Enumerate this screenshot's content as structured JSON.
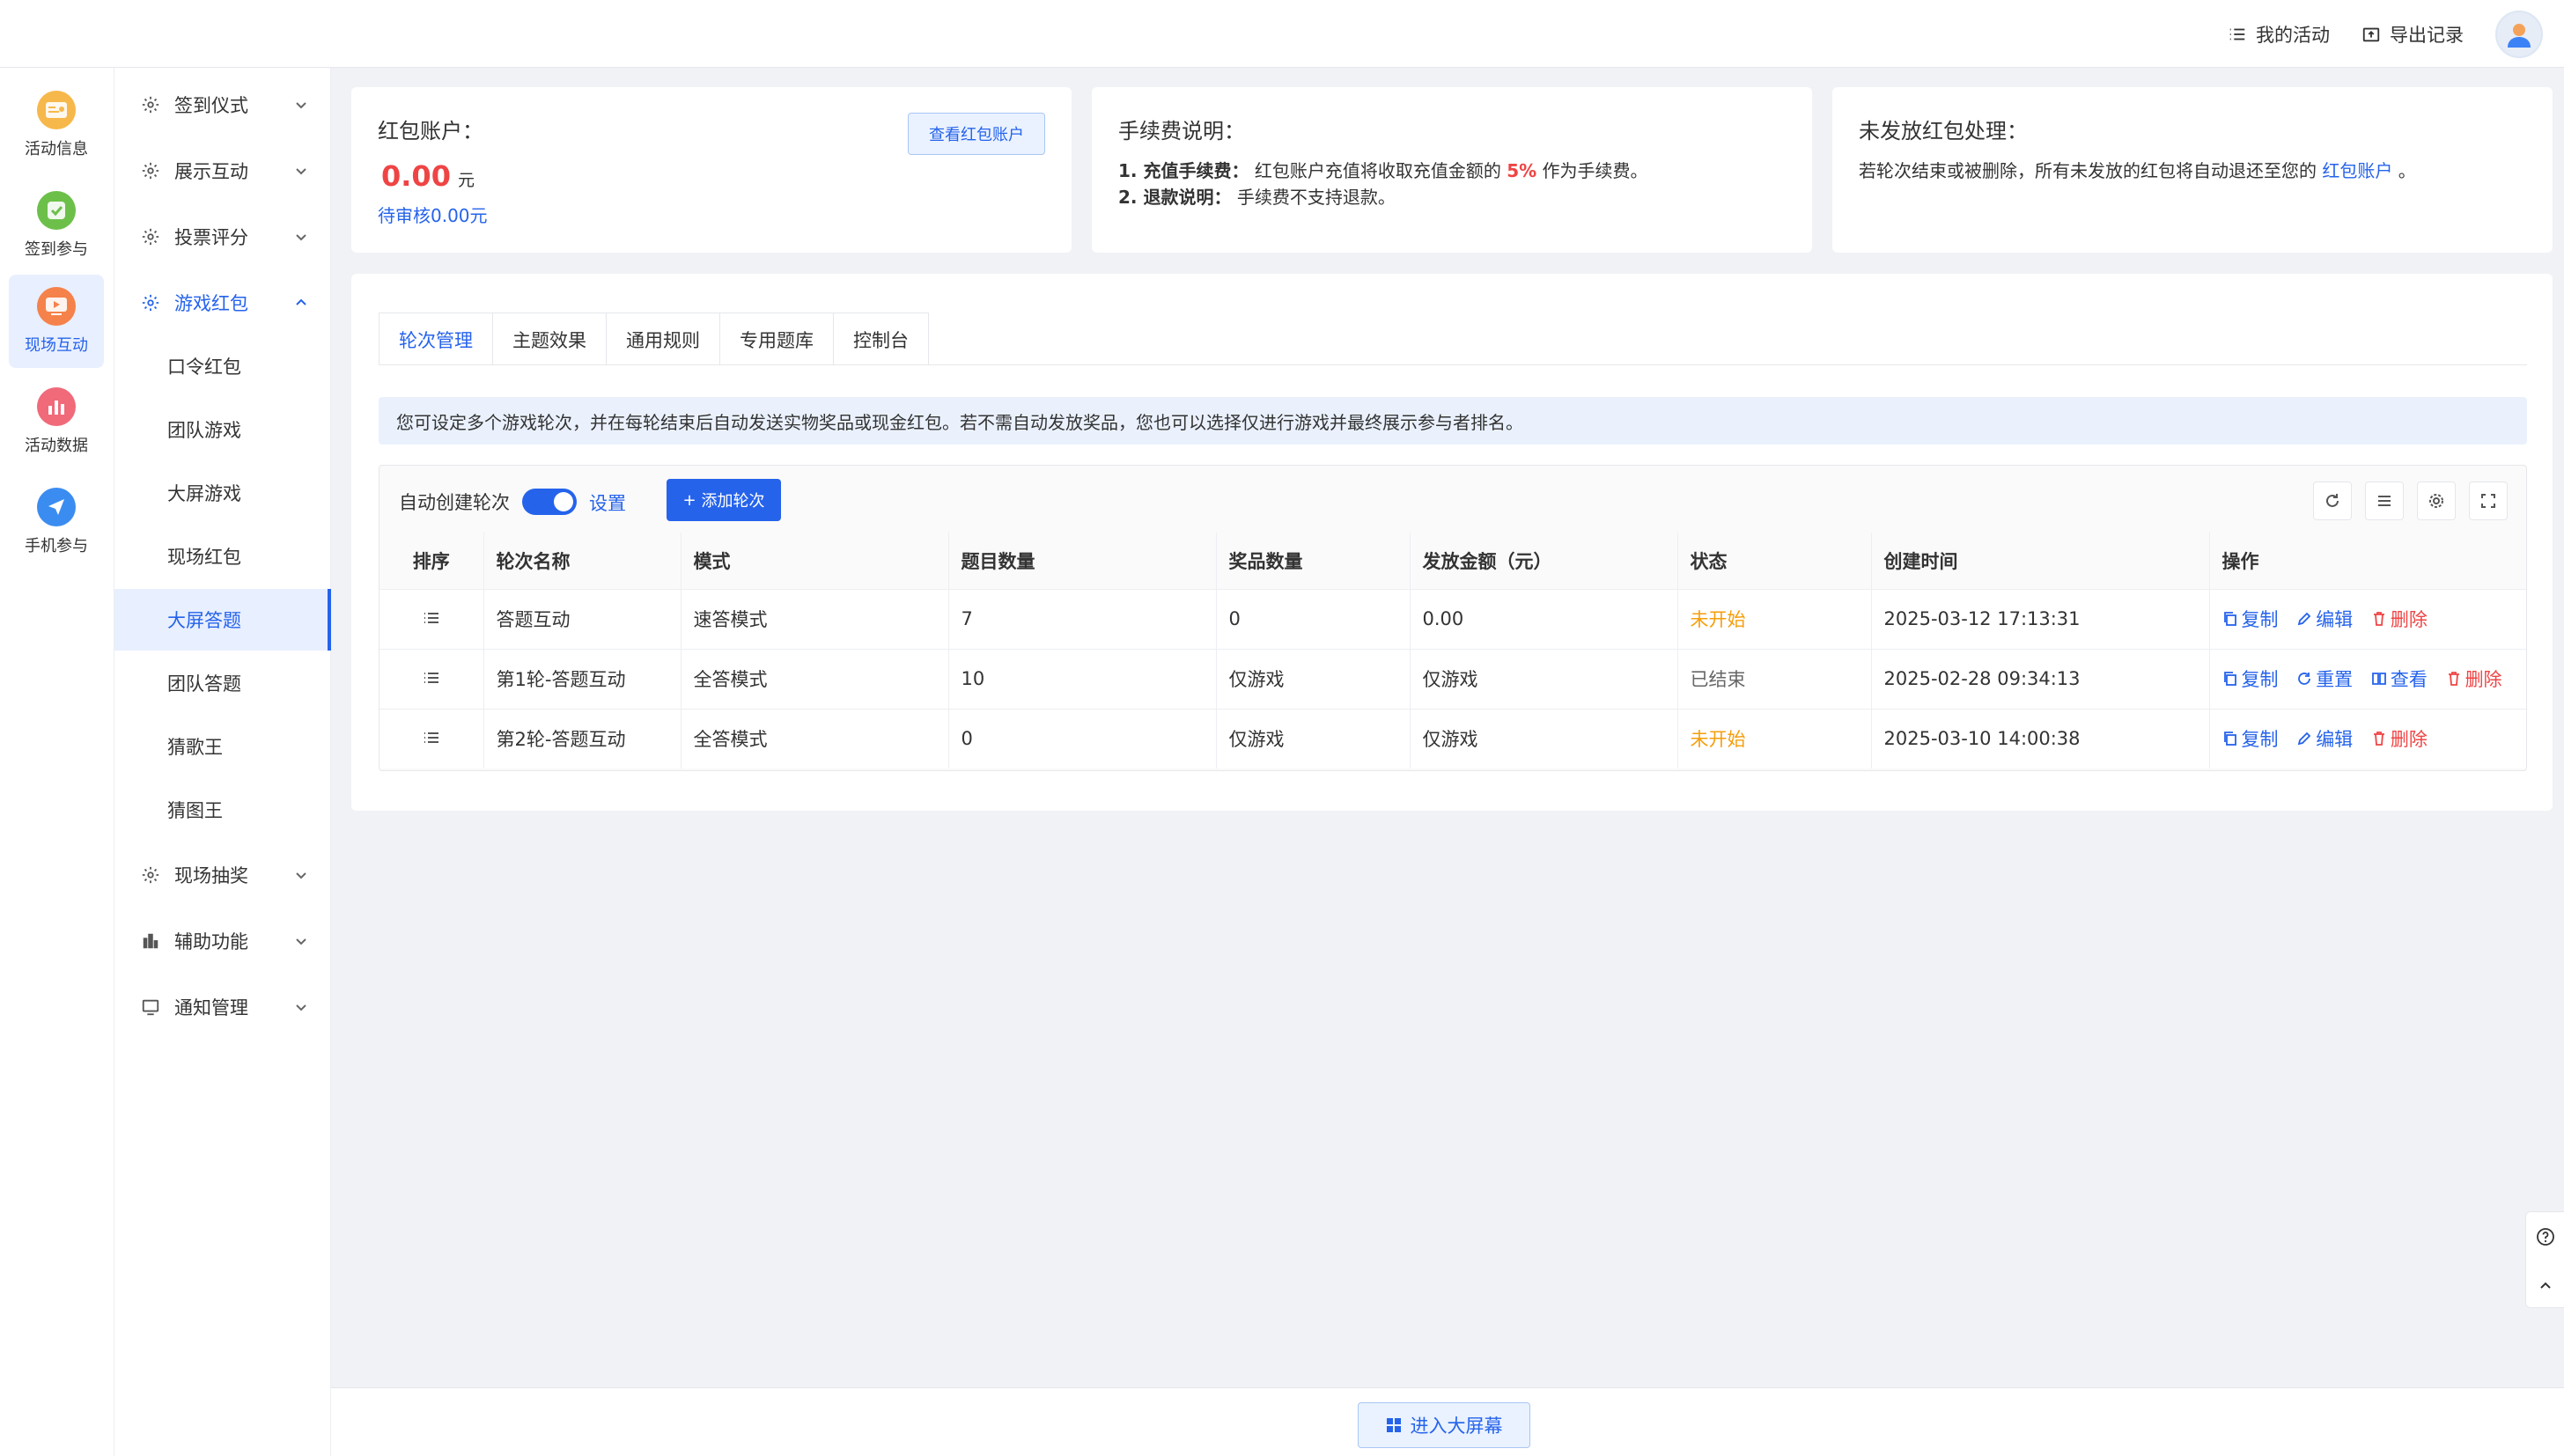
{
  "header": {
    "my_activity": "我的活动",
    "export_records": "导出记录"
  },
  "left_nav": [
    {
      "label": "活动信息",
      "icon": "activity-info-icon"
    },
    {
      "label": "签到参与",
      "icon": "checkin-icon"
    },
    {
      "label": "现场互动",
      "icon": "live-interaction-icon"
    },
    {
      "label": "活动数据",
      "icon": "activity-data-icon"
    },
    {
      "label": "手机参与",
      "icon": "mobile-icon"
    }
  ],
  "sub_nav": {
    "groups": {
      "g0": "签到仪式",
      "g1": "展示互动",
      "g2": "投票评分",
      "g3": "游戏红包",
      "g4": "现场抽奖",
      "g5": "辅助功能",
      "g6": "通知管理"
    },
    "items": [
      "口令红包",
      "团队游戏",
      "大屏游戏",
      "现场红包",
      "大屏答题",
      "团队答题",
      "猜歌王",
      "猜图王"
    ]
  },
  "cards": {
    "wallet": {
      "title": "红包账户：",
      "amount": "0.00",
      "unit": "元",
      "pending": "待审核0.00元",
      "button": "查看红包账户"
    },
    "fee": {
      "title": "手续费说明：",
      "l1_label": "1. 充值手续费：",
      "l1_text_a": "红包账户充值将收取充值金额的",
      "l1_rate": "5%",
      "l1_text_b": "作为手续费。",
      "l2_label": "2. 退款说明：",
      "l2_text": "手续费不支持退款。"
    },
    "unissued": {
      "title": "未发放红包处理：",
      "text_a": "若轮次结束或被删除，所有未发放的红包将自动退还至您的",
      "link": "红包账户",
      "text_b": "。"
    }
  },
  "tabs": [
    "轮次管理",
    "主题效果",
    "通用规则",
    "专用题库",
    "控制台"
  ],
  "notice": "您可设定多个游戏轮次，并在每轮结束后自动发送实物奖品或现金红包。若不需自动发放奖品，您也可以选择仅进行游戏并最终展示参与者排名。",
  "toolbar": {
    "auto_create": "自动创建轮次",
    "auto_create_on": true,
    "settings": "设置",
    "add_round": "添加轮次"
  },
  "table": {
    "headers": [
      "排序",
      "轮次名称",
      "模式",
      "题目数量",
      "奖品数量",
      "发放金额（元）",
      "状态",
      "创建时间",
      "操作"
    ],
    "rows": [
      {
        "name": "答题互动",
        "mode": "速答模式",
        "questions": "7",
        "prizes": "0",
        "amount": "0.00",
        "status": "未开始",
        "status_color": "#f59e0b",
        "created": "2025-03-12 17:13:31",
        "ops": [
          "复制",
          "编辑",
          "删除"
        ]
      },
      {
        "name": "第1轮-答题互动",
        "mode": "全答模式",
        "questions": "10",
        "prizes": "仅游戏",
        "amount": "仅游戏",
        "status": "已结束",
        "status_color": "#666666",
        "created": "2025-02-28 09:34:13",
        "ops": [
          "复制",
          "重置",
          "查看",
          "删除"
        ]
      },
      {
        "name": "第2轮-答题互动",
        "mode": "全答模式",
        "questions": "0",
        "prizes": "仅游戏",
        "amount": "仅游戏",
        "status": "未开始",
        "status_color": "#f59e0b",
        "created": "2025-03-10 14:00:38",
        "ops": [
          "复制",
          "编辑",
          "删除"
        ]
      }
    ]
  },
  "footer": {
    "enter_screen": "进入大屏幕"
  },
  "colors": {
    "primary": "#2563eb",
    "danger": "#ef4444",
    "warning": "#f59e0b"
  }
}
